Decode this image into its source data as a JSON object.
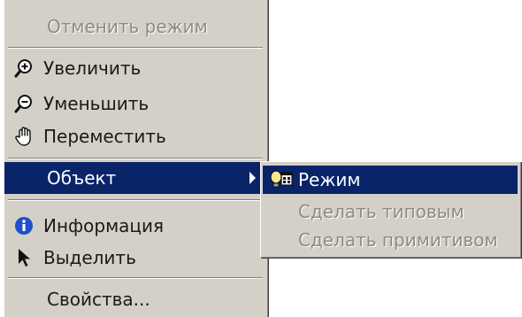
{
  "menu": {
    "cancel_mode": "Отменить режим",
    "zoom_in": "Увеличить",
    "zoom_out": "Уменьшить",
    "pan": "Переместить",
    "object": "Объект",
    "info": "Информация",
    "select": "Выделить",
    "properties": "Свойства..."
  },
  "submenu": {
    "mode": "Режим",
    "make_typical": "Сделать типовым",
    "make_primitive": "Сделать примитивом"
  },
  "colors": {
    "menu_bg": "#d4d0c8",
    "highlight": "#0a246a",
    "disabled_text": "#8c8a85",
    "info_icon": "#1f4fc8"
  },
  "icons": {
    "zoom_in": "magnifier-plus-icon",
    "zoom_out": "magnifier-minus-icon",
    "pan": "hand-icon",
    "object_arrow": "chevron-right-icon",
    "mode": "lightbulb-window-icon",
    "info": "info-icon",
    "select": "arrow-cursor-icon"
  }
}
